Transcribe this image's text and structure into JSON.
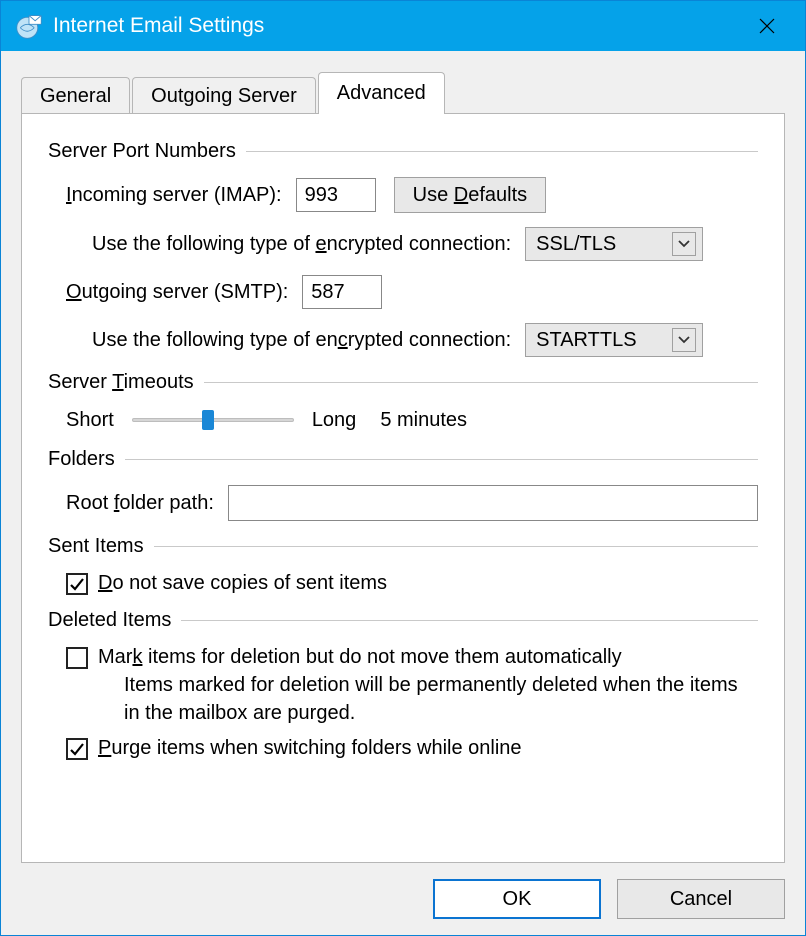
{
  "window": {
    "title": "Internet Email Settings"
  },
  "tabs": {
    "general": "General",
    "outgoing": "Outgoing Server",
    "advanced": "Advanced"
  },
  "groups": {
    "ports": "Server Port Numbers",
    "timeouts_pre": "Server ",
    "timeouts_u": "T",
    "timeouts_post": "imeouts",
    "folders": "Folders",
    "sent": "Sent Items",
    "deleted": "Deleted Items"
  },
  "ports": {
    "incoming_pre": "I",
    "incoming_post": "ncoming server (IMAP):",
    "incoming_value": "993",
    "usedefaults_pre": "Use ",
    "usedefaults_u": "D",
    "usedefaults_post": "efaults",
    "enc_pre": "Use the following type of ",
    "enc_u": "e",
    "enc_post": "ncrypted connection:",
    "incoming_enc": "SSL/TLS",
    "outgoing_pre": "O",
    "outgoing_post": "utgoing server (SMTP):",
    "outgoing_value": "587",
    "enc2_pre": "Use the following type of en",
    "enc2_u": "c",
    "enc2_post": "rypted connection:",
    "outgoing_enc": "STARTTLS"
  },
  "timeouts": {
    "short": "Short",
    "long": "Long",
    "value": "5 minutes"
  },
  "folders": {
    "root_pre": "Root ",
    "root_u": "f",
    "root_post": "older path:",
    "root_value": ""
  },
  "sent": {
    "nosave_pre": "D",
    "nosave_post": "o not save copies of sent items",
    "nosave_checked": true
  },
  "deleted": {
    "mark_pre": "Mar",
    "mark_u": "k",
    "mark_post": " items for deletion but do not move them automatically",
    "mark_checked": false,
    "help": "Items marked for deletion will be permanently deleted when the items in the mailbox are purged.",
    "purge_pre": "P",
    "purge_post": "urge items when switching folders while online",
    "purge_checked": true
  },
  "buttons": {
    "ok": "OK",
    "cancel": "Cancel"
  }
}
